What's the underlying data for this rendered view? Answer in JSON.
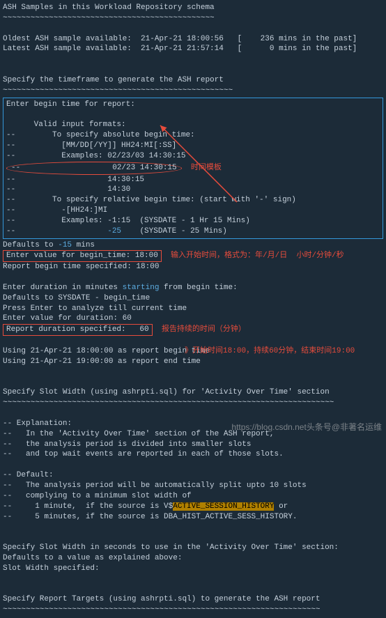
{
  "header": {
    "title": "ASH Samples in this Workload Repository schema",
    "sep": "~~~~~~~~~~~~~~~~~~~~~~~~~~~~~~~~~~~~~~~~~~~~~~"
  },
  "samples": {
    "oldest_label": "Oldest ASH sample available:  21-Apr-21 18:00:56   [    236 mins in the past]",
    "latest_label": "Latest ASH sample available:  21-Apr-21 21:57:14   [      0 mins in the past]"
  },
  "timeframe": {
    "title": "Specify the timeframe to generate the ASH report",
    "sep": "~~~~~~~~~~~~~~~~~~~~~~~~~~~~~~~~~~~~~~~~~~~~~~~~~~"
  },
  "begin_block": {
    "enter": "Enter begin time for report:",
    "valid_formats": "      Valid input formats:",
    "abs_spec": "--        To specify absolute begin time:",
    "fmt_line": "--          [MM/DD[/YY]] HH24:MI[:SS]",
    "ex_label": "--          Examples: 02/23/03 14:30:15",
    "ex2": "--                    02/23 14:30:15",
    "ex3": "--                    14:30:15",
    "ex4": "--                    14:30",
    "rel_spec": "--        To specify relative begin time: (start with '-' sign)",
    "rel_fmt": "--          -[HH24:]MI",
    "rel_ex1": "--          Examples: -1:15  (SYSDATE - 1 Hr 15 Mins)",
    "rel_ex2": "--                    ",
    "rel_ex2_val": "-25",
    "rel_ex2_suffix": "    (SYSDATE - 25 Mins)",
    "ellipse_templates": "时间模板"
  },
  "defaults_line": "Defaults to ",
  "defaults_val": "-15",
  "defaults_suffix": " mins",
  "begin_time_prompt": "Enter value for begin_time: 18:00",
  "begin_time_anno": "输入开始时间，格式为：年/月/日  小时/分钟/秒",
  "report_begin": "Report begin time specified: 18:00",
  "duration": {
    "enter": "Enter duration in minutes ",
    "starting": "starting",
    "enter_suffix": " from begin time:",
    "default1": "Defaults to SYSDATE - begin_time",
    "default2": "Press Enter to analyze till current time",
    "value": "Enter value for duration: 60",
    "report_spec": "Report duration specified:   60",
    "anno": "报告持续的时间（分钟）"
  },
  "using1": "Using 21-Apr-21 18:00:00 as report begin time",
  "using1_anno": "》开始时间18:00，持续60分钟，结束时间19:00",
  "using2": "Using 21-Apr-21 19:00:00 as report end time",
  "slot_width": {
    "title": "Specify Slot Width (using ashrpti.sql) for 'Activity Over Time' section",
    "sep": "~~~~~~~~~~~~~~~~~~~~~~~~~~~~~~~~~~~~~~~~~~~~~~~~~~~~~~~~~~~~~~~~~~~~~~~~"
  },
  "explanation": {
    "hdr": "-- Explanation:",
    "l1": "--   In the 'Activity Over Time' section of the ASH report,",
    "l2": "--   the analysis period is divided into smaller slots",
    "l3": "--   and top wait events are reported in each of those slots."
  },
  "default_block": {
    "hdr": "-- Default:",
    "l1": "--   The analysis period will be automatically split upto 10 slots",
    "l2": "--   complying to a minimum slot width of",
    "l3_pre": "--     1 minute,  if the source is V$",
    "l3_hl": "ACTIVE_SESSION_HISTORY",
    "l3_suf": " or",
    "l4": "--     5 minutes, if the source is DBA_HIST_ACTIVE_SESS_HISTORY."
  },
  "slot2": {
    "title": "Specify Slot Width in seconds to use in the 'Activity Over Time' section:",
    "l1": "Defaults to a value as explained above:",
    "l2": "Slot Width specified:"
  },
  "report_targets": {
    "title": "Specify Report Targets (using ashrpti.sql) to generate the ASH report",
    "sep": "~~~~~~~~~~~~~~~~~~~~~~~~~~~~~~~~~~~~~~~~~~~~~~~~~~~~~~~~~~~~~~~~~~~~~"
  },
  "watermark": "https://blog.csdn.net头条号@非著名运维"
}
